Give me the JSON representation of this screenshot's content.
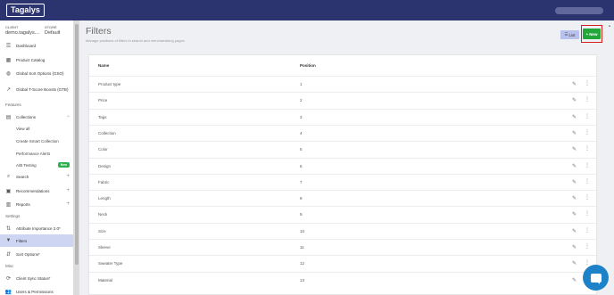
{
  "topbar": {
    "logo": "Tagalys"
  },
  "context": {
    "client_label": "CLIENT",
    "client_value": "demo.tagalys....",
    "store_label": "STORE",
    "store_value": "Default"
  },
  "sidebar": {
    "items": [
      {
        "label": "Dashboard",
        "icon": "list-icon"
      },
      {
        "label": "Product Catalog",
        "icon": "grid-icon"
      },
      {
        "label": "Global Sort Options (GSO)",
        "icon": "globe-icon"
      },
      {
        "label": "Global T-Score Boosts (GTB)",
        "icon": "trend-icon"
      }
    ],
    "features_label": "Features",
    "collections": {
      "label": "Collections",
      "trail": "−"
    },
    "collection_subs": [
      "View all",
      "Create Smart Collection",
      "Performance Alerts",
      "A/B Testing"
    ],
    "ab_badge": "New",
    "features2": [
      {
        "label": "Search",
        "trail": "+"
      },
      {
        "label": "Recommendations",
        "trail": "+"
      },
      {
        "label": "Reports",
        "trail": "+"
      }
    ],
    "settings_label": "Settings",
    "settings_items": [
      "Attribute Importance 2.0*",
      "Filters",
      "Sort Options*"
    ],
    "misc_label": "Misc",
    "misc_items": [
      "Client Sync Status*",
      "Users & Permissions"
    ]
  },
  "page": {
    "title": "Filters",
    "subtitle": "Manage positions of filters in search and merchandising pages",
    "list_button": "List",
    "new_button": "New"
  },
  "table": {
    "headers": [
      "Name",
      "Position"
    ],
    "rows": [
      {
        "name": "Product type",
        "position": "1"
      },
      {
        "name": "Price",
        "position": "2"
      },
      {
        "name": "Tags",
        "position": "3"
      },
      {
        "name": "Collection",
        "position": "4"
      },
      {
        "name": "Color",
        "position": "5"
      },
      {
        "name": "Design",
        "position": "6"
      },
      {
        "name": "Fabric",
        "position": "7"
      },
      {
        "name": "Length",
        "position": "8"
      },
      {
        "name": "Neck",
        "position": "9"
      },
      {
        "name": "Size",
        "position": "10"
      },
      {
        "name": "Sleeve",
        "position": "11"
      },
      {
        "name": "Sweater Type",
        "position": "12"
      },
      {
        "name": "Material",
        "position": "13"
      }
    ]
  },
  "colors": {
    "topbar": "#2c3470",
    "accent": "#22a83a",
    "highlight": "#d91c1c",
    "active": "#cdd5f3"
  }
}
